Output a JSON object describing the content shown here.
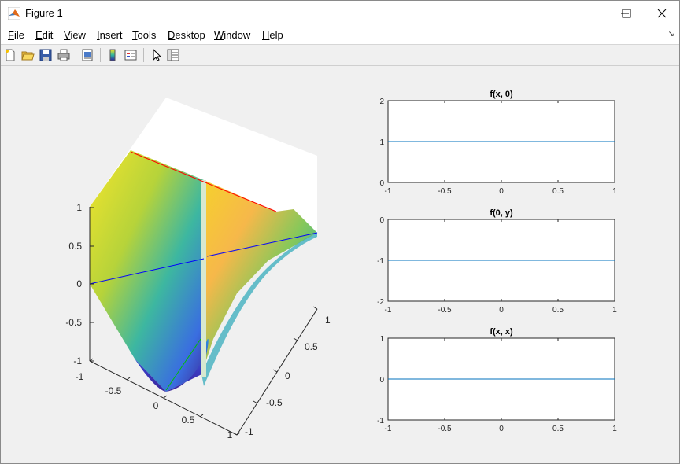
{
  "window": {
    "title": "Figure 1"
  },
  "menu": {
    "items": [
      "File",
      "Edit",
      "View",
      "Insert",
      "Tools",
      "Desktop",
      "Window",
      "Help"
    ]
  },
  "toolbar": {
    "buttons": [
      "new-figure",
      "open-file",
      "save-figure",
      "print-figure",
      "print-preview",
      "insert-colorbar",
      "insert-legend",
      "edit-plot",
      "property-inspector"
    ]
  },
  "colors": {
    "line": "#0072BD",
    "edge_red": "#ff0000",
    "edge_blue": "#0000ff",
    "edge_green": "#00c000"
  },
  "surface_axes": {
    "z_ticks": [
      "1",
      "0.5",
      "0",
      "-0.5",
      "-1"
    ],
    "x_ticks": [
      "-1",
      "-0.5",
      "0",
      "0.5",
      "1"
    ],
    "y_ticks": [
      "1",
      "0.5",
      "0",
      "-0.5",
      "-1"
    ]
  },
  "chart_data": [
    {
      "type": "line",
      "title": "f(x, 0)",
      "x": [
        -1,
        0,
        1
      ],
      "series": [
        {
          "values": [
            1,
            1,
            1
          ]
        }
      ],
      "xlim": [
        -1,
        1
      ],
      "ylim": [
        0,
        2
      ],
      "x_ticks": [
        "-1",
        "-0.5",
        "0",
        "0.5",
        "1"
      ],
      "y_ticks": [
        "2",
        "1",
        "0"
      ]
    },
    {
      "type": "line",
      "title": "f(0, y)",
      "x": [
        -1,
        0,
        1
      ],
      "series": [
        {
          "values": [
            -1,
            -1,
            -1
          ]
        }
      ],
      "xlim": [
        -1,
        1
      ],
      "ylim": [
        -2,
        0
      ],
      "x_ticks": [
        "-1",
        "-0.5",
        "0",
        "0.5",
        "1"
      ],
      "y_ticks": [
        "0",
        "-1",
        "-2"
      ]
    },
    {
      "type": "line",
      "title": "f(x, x)",
      "x": [
        -1,
        0,
        1
      ],
      "series": [
        {
          "values": [
            0,
            0,
            0
          ]
        }
      ],
      "xlim": [
        -1,
        1
      ],
      "ylim": [
        -1,
        1
      ],
      "x_ticks": [
        "-1",
        "-0.5",
        "0",
        "0.5",
        "1"
      ],
      "y_ticks": [
        "1",
        "0",
        "-1"
      ]
    }
  ]
}
